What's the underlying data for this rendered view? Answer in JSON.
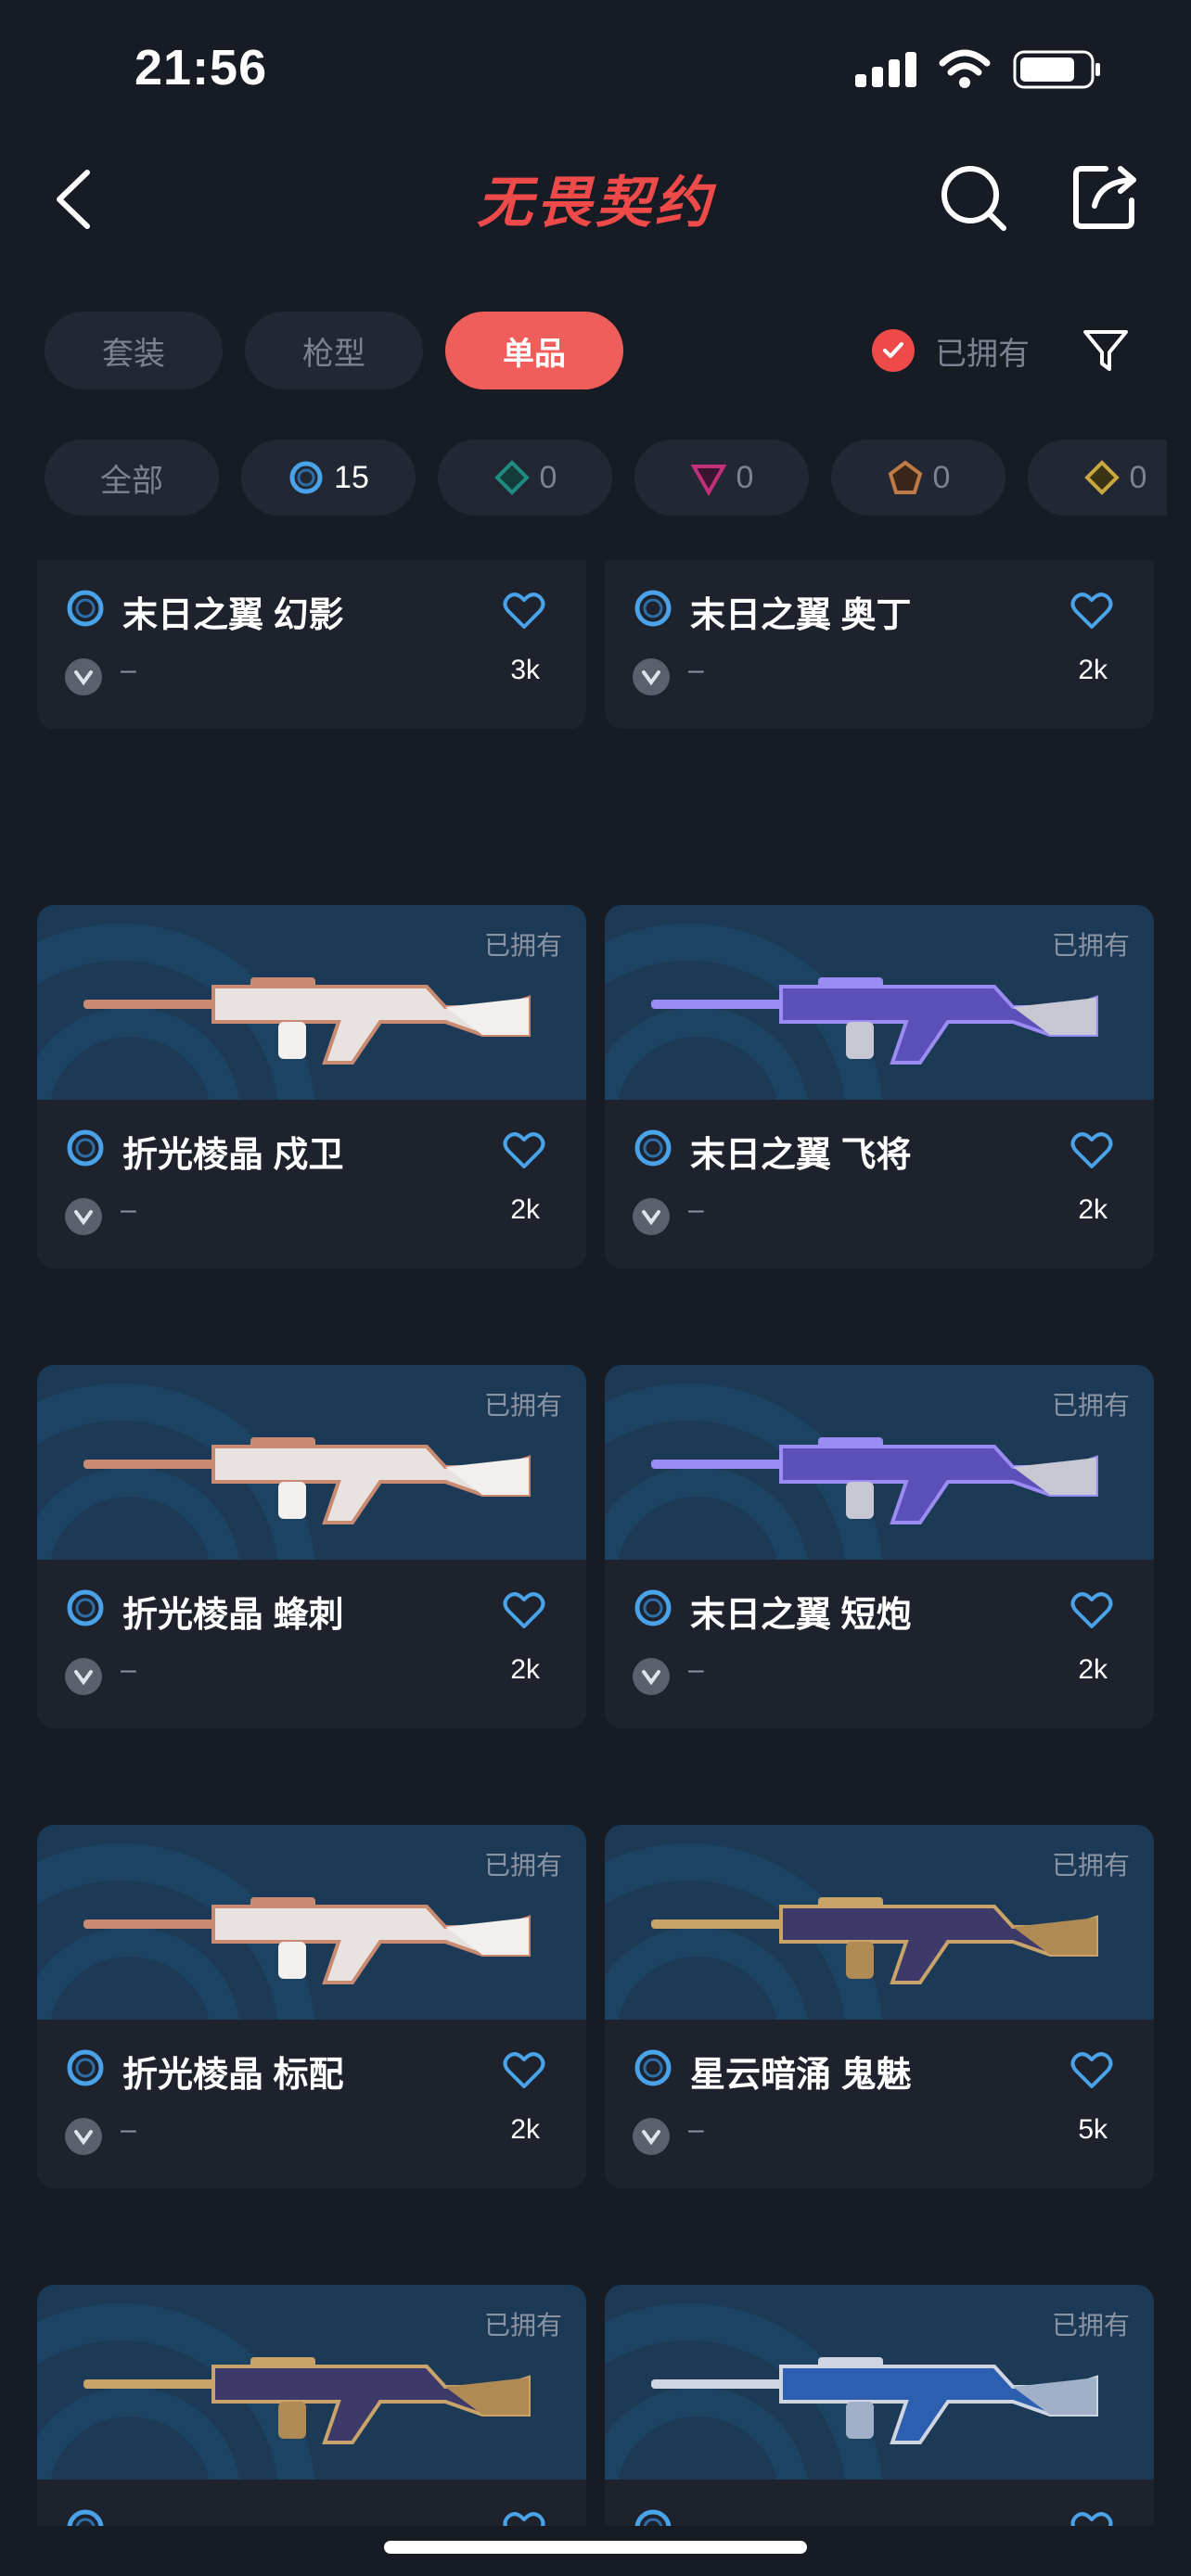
{
  "status": {
    "time": "21:56"
  },
  "header": {
    "title": "无畏契约"
  },
  "tabs": [
    {
      "label": "套装",
      "active": false
    },
    {
      "label": "枪型",
      "active": false
    },
    {
      "label": "单品",
      "active": true
    }
  ],
  "owned_filter": {
    "label": "已拥有",
    "checked": true
  },
  "rarity_chips": [
    {
      "label": "全部"
    },
    {
      "count": "15",
      "icon": "blue-ring-icon",
      "color": "#4aa3e8"
    },
    {
      "count": "0",
      "icon": "green-diamond-icon",
      "color": "#1e8c80"
    },
    {
      "count": "0",
      "icon": "pink-triangle-icon",
      "color": "#c2307a"
    },
    {
      "count": "0",
      "icon": "orange-pentagon-icon",
      "color": "#c07a45"
    },
    {
      "count": "0",
      "icon": "yellow-diamond-icon",
      "color": "#c9a93e"
    }
  ],
  "items": [
    {
      "name": "末日之翼 幻影",
      "owned_label": "",
      "tier": "–",
      "likes": "3k",
      "style": "purple"
    },
    {
      "name": "末日之翼 奥丁",
      "owned_label": "",
      "tier": "–",
      "likes": "2k",
      "style": "purple"
    },
    {
      "name": "折光棱晶 戍卫",
      "owned_label": "已拥有",
      "tier": "–",
      "likes": "2k",
      "style": "rose"
    },
    {
      "name": "末日之翼 飞将",
      "owned_label": "已拥有",
      "tier": "–",
      "likes": "2k",
      "style": "purple"
    },
    {
      "name": "折光棱晶 蜂刺",
      "owned_label": "已拥有",
      "tier": "–",
      "likes": "2k",
      "style": "rose"
    },
    {
      "name": "末日之翼 短炮",
      "owned_label": "已拥有",
      "tier": "–",
      "likes": "2k",
      "style": "purple"
    },
    {
      "name": "折光棱晶 标配",
      "owned_label": "已拥有",
      "tier": "–",
      "likes": "2k",
      "style": "rose"
    },
    {
      "name": "星云暗涌 鬼魅",
      "owned_label": "已拥有",
      "tier": "–",
      "likes": "5k",
      "style": "gold"
    },
    {
      "name": "",
      "owned_label": "已拥有",
      "tier": "",
      "likes": "",
      "style": "gold"
    },
    {
      "name": "",
      "owned_label": "已拥有",
      "tier": "",
      "likes": "",
      "style": "blue"
    }
  ]
}
